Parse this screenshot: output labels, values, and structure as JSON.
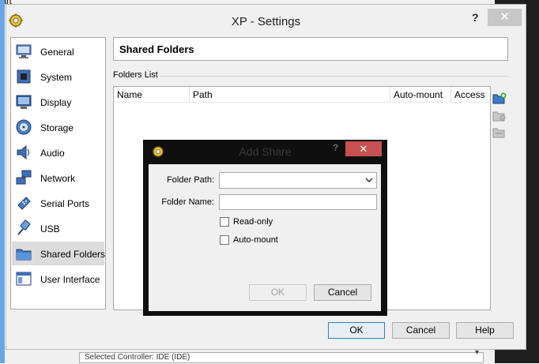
{
  "background": {
    "top_text": "art",
    "bottom_field_text": "Selected Controller: IDE (IDE)",
    "bottom_scroll_glyph": "▾"
  },
  "window": {
    "title": "XP - Settings",
    "help_glyph": "?",
    "close_glyph": "✕"
  },
  "sidebar": {
    "items": [
      {
        "label": "General",
        "icon": "monitor-general-icon"
      },
      {
        "label": "System",
        "icon": "chip-icon"
      },
      {
        "label": "Display",
        "icon": "display-icon"
      },
      {
        "label": "Storage",
        "icon": "storage-disk-icon"
      },
      {
        "label": "Audio",
        "icon": "speaker-icon"
      },
      {
        "label": "Network",
        "icon": "network-icon"
      },
      {
        "label": "Serial Ports",
        "icon": "serial-port-icon"
      },
      {
        "label": "USB",
        "icon": "usb-icon"
      },
      {
        "label": "Shared Folders",
        "icon": "folder-icon",
        "active": true
      },
      {
        "label": "User Interface",
        "icon": "window-icon"
      }
    ]
  },
  "main": {
    "section_title": "Shared Folders",
    "folders_list_label": "Folders List",
    "columns": [
      "Name",
      "Path",
      "Auto-mount",
      "Access"
    ],
    "rows": []
  },
  "buttons": {
    "ok": "OK",
    "cancel": "Cancel",
    "help": "Help"
  },
  "dialog": {
    "title": "Add Share",
    "help_glyph": "?",
    "close_glyph": "✕",
    "folder_path_label": "Folder Path:",
    "folder_path_value": "",
    "folder_name_label": "Folder Name:",
    "folder_name_value": "",
    "readonly_label": "Read-only",
    "readonly_checked": false,
    "automount_label": "Auto-mount",
    "automount_checked": false,
    "ok": "OK",
    "cancel": "Cancel"
  },
  "colors": {
    "dialog_close": "#c75050",
    "window_bg": "#f0f0f0",
    "selected_item": "#dcdcdc",
    "default_button_border": "#3c7fb1"
  }
}
